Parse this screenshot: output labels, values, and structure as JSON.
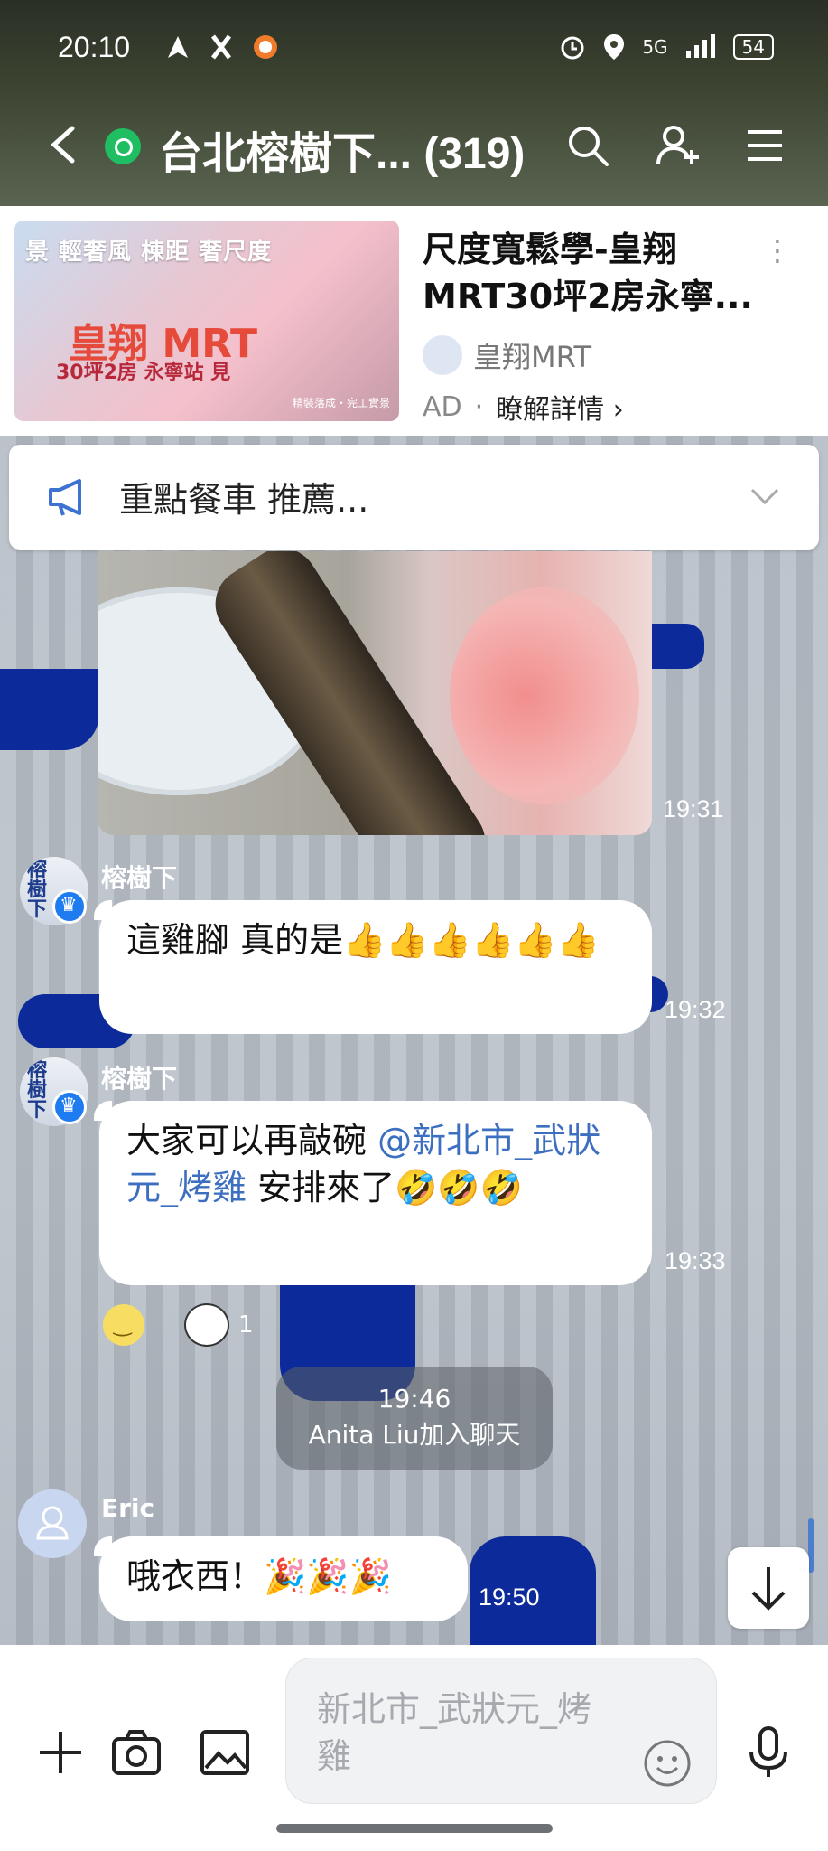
{
  "status_bar": {
    "time": "20:10",
    "network": "5G",
    "battery": "54"
  },
  "header": {
    "title": "台北榕樹下... (319)"
  },
  "ad": {
    "title": "尺度寬鬆學-皇翔MRT30坪2房永寧...",
    "brand": "皇翔MRT",
    "label": "AD",
    "link": "瞭解詳情 ›",
    "image_tagline": "景 輕奢風 棟距 奢尺度",
    "image_logo": "皇翔 MRT",
    "image_sub": "30坪2房 永寧站 見",
    "image_footer": "精裝落成・完工實景"
  },
  "announcement": {
    "text": "重點餐車 推薦..."
  },
  "messages": {
    "photo_time": "19:31",
    "msg1": {
      "sender": "榕樹下",
      "avatar_text": "榕樹下",
      "text": "這雞腳 真的是👍👍👍👍👍👍",
      "time": "19:32"
    },
    "msg2": {
      "sender": "榕樹下",
      "avatar_text": "榕樹下",
      "text_pre": "大家可以再敲碗 ",
      "mention": "@新北市_武狀元_烤雞",
      "text_post": " 安排來了🤣🤣🤣",
      "time": "19:33",
      "reaction_count": "1"
    },
    "system": {
      "time": "19:46",
      "text": "Anita Liu加入聊天"
    },
    "msg3": {
      "sender": "Eric",
      "text": "哦衣西！🎉🎉🎉",
      "time": "19:50"
    }
  },
  "input": {
    "placeholder": "新北市_武狀元_烤雞"
  }
}
